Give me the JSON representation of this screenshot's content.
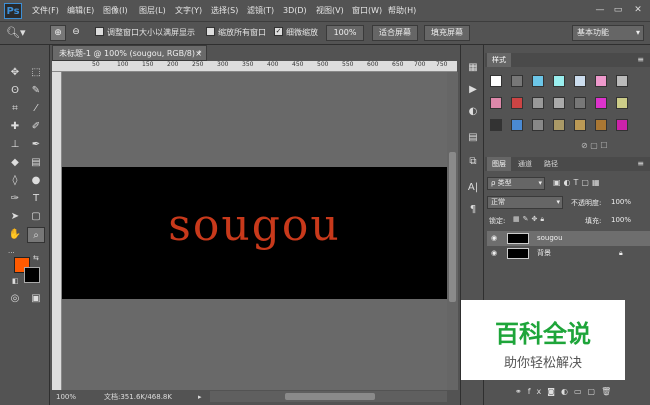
{
  "app": {
    "logo": "Ps"
  },
  "menu": [
    "文件(F)",
    "编辑(E)",
    "图像(I)",
    "图层(L)",
    "文字(Y)",
    "选择(S)",
    "滤镜(T)",
    "3D(D)",
    "视图(V)",
    "窗口(W)",
    "帮助(H)"
  ],
  "window_controls": {
    "minimize": "—",
    "restore": "▭",
    "close": "✕"
  },
  "options": {
    "resize_windows_label": "调整窗口大小以满屏显示",
    "zoom_all_label": "缩放所有窗口",
    "scrubby_label": "细微缩放",
    "zoom_100": "100%",
    "fit_screen": "适合屏幕",
    "fill_screen": "填充屏幕",
    "workspace": "基本功能"
  },
  "document": {
    "tab_title": "未标题-1 @ 100% (sougou, RGB/8) *",
    "canvas_text": "sougou",
    "zoom": "100%",
    "doc_info": "文档:351.6K/468.8K"
  },
  "ruler_ticks": [
    "50",
    "100",
    "150",
    "200",
    "250",
    "300",
    "350",
    "400",
    "450",
    "500",
    "550",
    "600",
    "650",
    "700",
    "750"
  ],
  "styles_panel": {
    "tab": "样式"
  },
  "layers_panel": {
    "tabs": [
      "图层",
      "通道",
      "路径"
    ],
    "kind_label": "ρ 类型",
    "blend_mode": "正常",
    "opacity_label": "不透明度:",
    "opacity_value": "100%",
    "lock_label": "锁定:",
    "fill_label": "填充:",
    "fill_value": "100%",
    "layers": [
      {
        "name": "sougou",
        "visible_icon": "◉"
      },
      {
        "name": "背景",
        "visible_icon": "◉"
      }
    ]
  },
  "watermark": {
    "main": "百科全说",
    "sub": "助你轻松解决"
  },
  "colors": {
    "foreground": "#ff5a00",
    "background": "#000000",
    "canvas_text": "#c8391b",
    "watermark_green": "#1ea53a"
  }
}
